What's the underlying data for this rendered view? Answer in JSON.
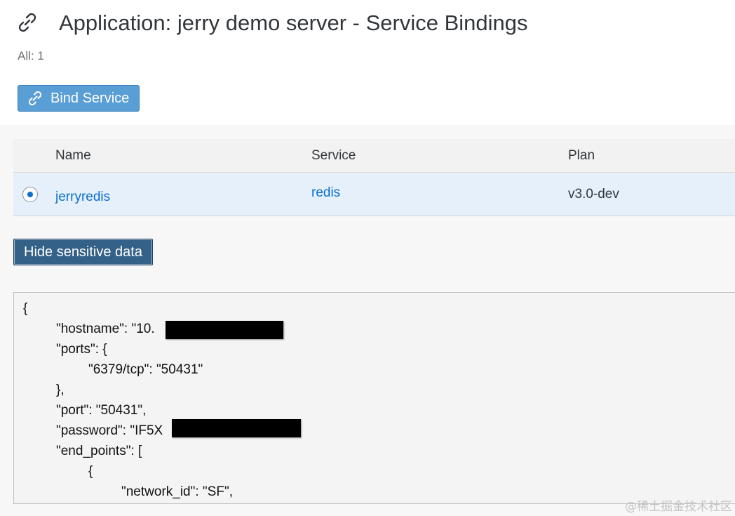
{
  "header": {
    "icon": "link-icon",
    "title": "Application: jerry demo server - Service Bindings",
    "count_label": "All: 1"
  },
  "toolbar": {
    "bind_label": "Bind Service",
    "bind_icon": "link-icon"
  },
  "table": {
    "columns": [
      "Name",
      "Service",
      "Plan"
    ],
    "rows": [
      {
        "name": "jerryredis",
        "service": "redis",
        "plan": "v3.0-dev",
        "selected": true
      }
    ]
  },
  "actions": {
    "hide_label": "Hide sensitive data"
  },
  "credentials": {
    "lines": [
      "{",
      "\"hostname\": \"10.",
      "\"ports\": {",
      "\"6379/tcp\": \"50431\"",
      "},",
      "\"port\": \"50431\",",
      "\"password\": \"IF5X",
      "\"end_points\": [",
      "{",
      "\"network_id\": \"SF\","
    ]
  },
  "watermark": "@稀土掘金技术社区",
  "colors": {
    "accent": "#0a6ed1",
    "bind_button": "#5a9ed6",
    "hide_button": "#346187",
    "selected_row": "#e5f0fa"
  }
}
